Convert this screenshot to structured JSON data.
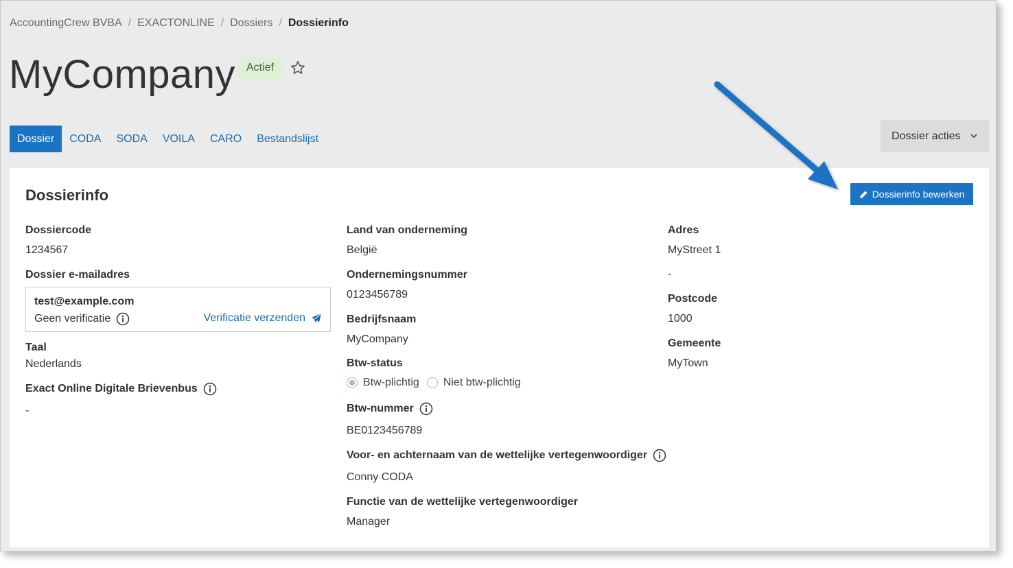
{
  "breadcrumb": {
    "items": [
      "AccountingCrew BVBA",
      "EXACTONLINE",
      "Dossiers"
    ],
    "current": "Dossierinfo",
    "separator": "/"
  },
  "header": {
    "title": "MyCompany",
    "status_badge": "Actief"
  },
  "tabs": [
    {
      "label": "Dossier",
      "active": true
    },
    {
      "label": "CODA"
    },
    {
      "label": "SODA"
    },
    {
      "label": "VOILA"
    },
    {
      "label": "CARO"
    },
    {
      "label": "Bestandslijst"
    }
  ],
  "actions": {
    "dossier_acties_label": "Dossier acties"
  },
  "card": {
    "title": "Dossierinfo",
    "edit_button_label": "Dossierinfo bewerken"
  },
  "col1": {
    "dossiercode_label": "Dossiercode",
    "dossiercode_value": "1234567",
    "email_label": "Dossier e-mailadres",
    "email_value": "test@example.com",
    "verification_status": "Geen verificatie",
    "send_verification_label": "Verificatie verzenden",
    "taal_label": "Taal",
    "taal_value": "Nederlands",
    "brievenbus_label": "Exact Online Digitale Brievenbus",
    "brievenbus_value": "-"
  },
  "col2": {
    "land_label": "Land van onderneming",
    "land_value": "België",
    "ondernemingsnummer_label": "Ondernemingsnummer",
    "ondernemingsnummer_value": "0123456789",
    "bedrijfsnaam_label": "Bedrijfsnaam",
    "bedrijfsnaam_value": "MyCompany",
    "btw_status_label": "Btw-status",
    "btw_options": [
      "Btw-plichtig",
      "Niet btw-plichtig"
    ],
    "btw_selected": "Btw-plichtig",
    "btw_nummer_label": "Btw-nummer",
    "btw_nummer_value": "BE0123456789",
    "vertegenwoordiger_naam_label": "Voor- en achternaam van de wettelijke vertegenwoordiger",
    "vertegenwoordiger_naam_value": "Conny CODA",
    "vertegenwoordiger_functie_label": "Functie van de wettelijke vertegenwoordiger",
    "vertegenwoordiger_functie_value": "Manager"
  },
  "col3": {
    "adres_label": "Adres",
    "adres_line1": "MyStreet 1",
    "adres_line2": "-",
    "postcode_label": "Postcode",
    "postcode_value": "1000",
    "gemeente_label": "Gemeente",
    "gemeente_value": "MyTown"
  },
  "colors": {
    "primary": "#1a73c4",
    "link": "#1a6db3",
    "badge_bg": "#e0f0d6",
    "badge_text": "#3d6b2c",
    "page_bg": "#ebebeb",
    "annotation_arrow": "#1a73c4"
  },
  "icons": {
    "star": "star-outline-icon",
    "chevron": "chevron-down-icon",
    "edit": "pencil-icon",
    "info": "info-circle-icon",
    "send": "paper-plane-icon",
    "annotation": "arrow-annotation-icon"
  }
}
